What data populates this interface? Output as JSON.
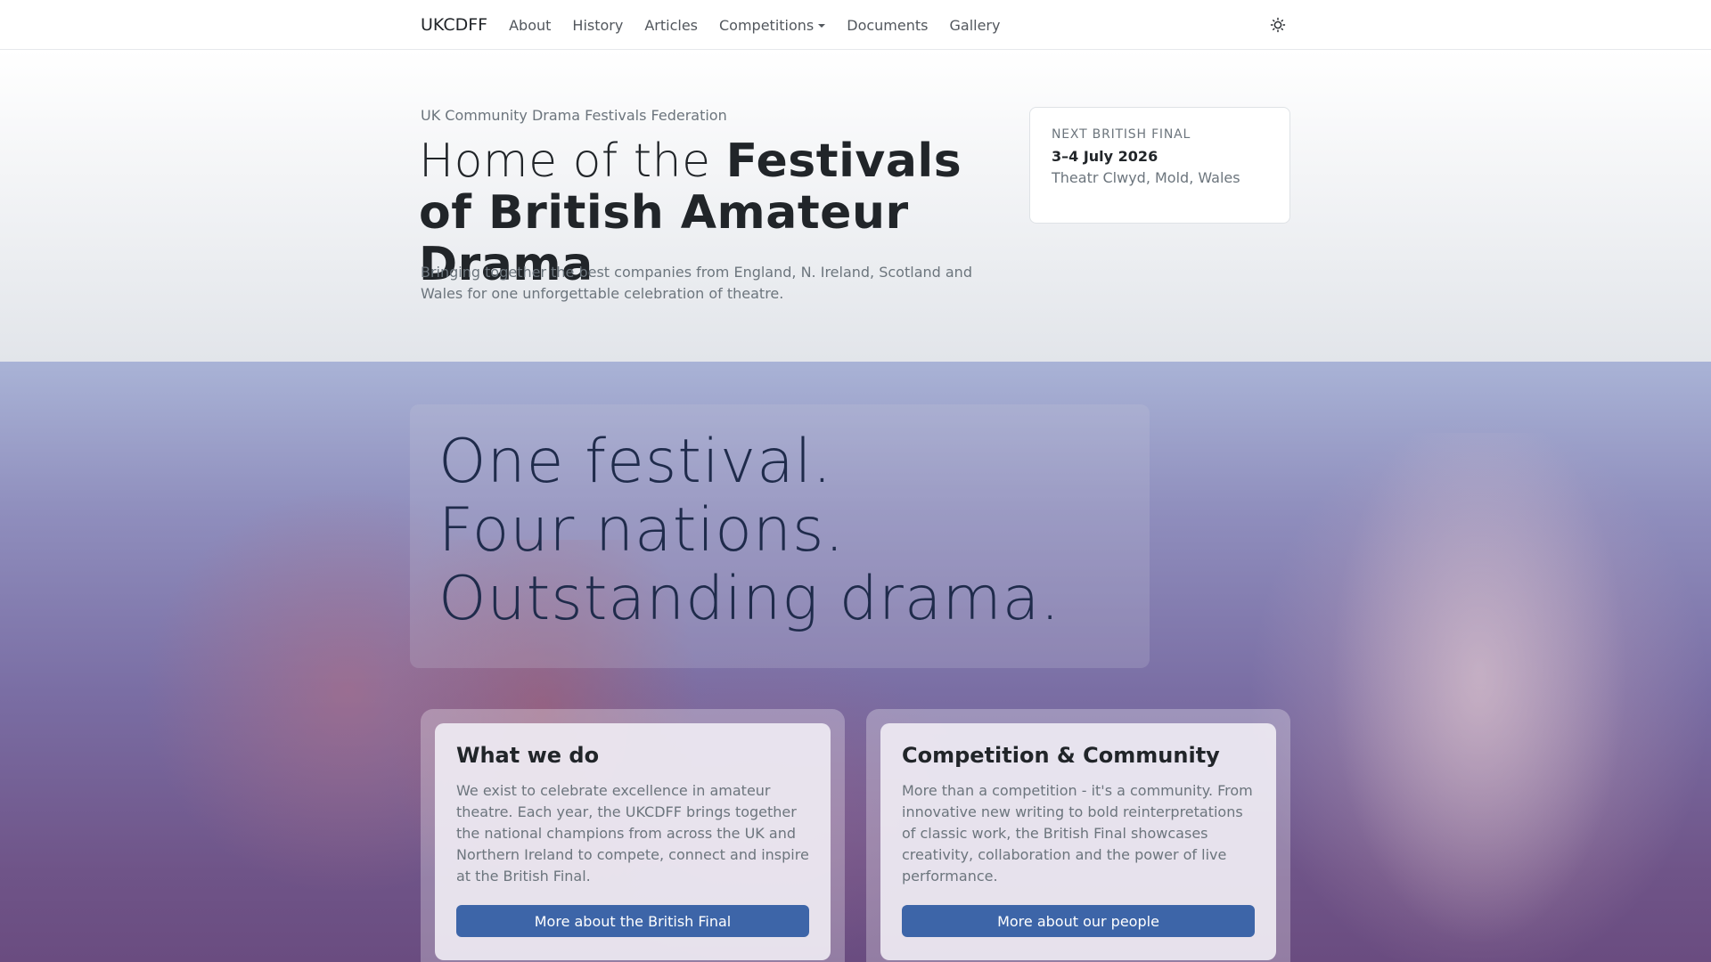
{
  "nav": {
    "brand": "UKCDFF",
    "links": [
      "About",
      "History",
      "Articles",
      "Competitions",
      "Documents",
      "Gallery"
    ],
    "theme_icon": "sun-icon"
  },
  "hero": {
    "eyebrow": "UK Community Drama Festivals Federation",
    "title_light": "Home of the ",
    "title_bold": "Festivals of British Amateur Drama",
    "lead": "Bringing together the best companies from England, N. Ireland, Scotland and Wales for one unforgettable celebration of theatre."
  },
  "final": {
    "label": "Next British Final",
    "date": "3–4 July 2026",
    "venue": "Theatr Clwyd, Mold, Wales"
  },
  "tagline": [
    "One festival.",
    "Four nations.",
    "Outstanding drama."
  ],
  "cards": [
    {
      "title": "What we do",
      "text": "We exist to celebrate excellence in amateur theatre. Each year, the UKCDFF brings together the national champions from across the UK and Northern Ireland to compete, connect and inspire at the British Final.",
      "button": "More about the British Final"
    },
    {
      "title": "Competition & Community",
      "text": "More than a competition - it's a community. From innovative new writing to bold reinterpretations of classic work, the British Final showcases creativity, collaboration and the power of live performance.",
      "button": "More about our people"
    }
  ],
  "colors": {
    "button": "#3d65a8",
    "tagline": "#1f2b4b"
  }
}
